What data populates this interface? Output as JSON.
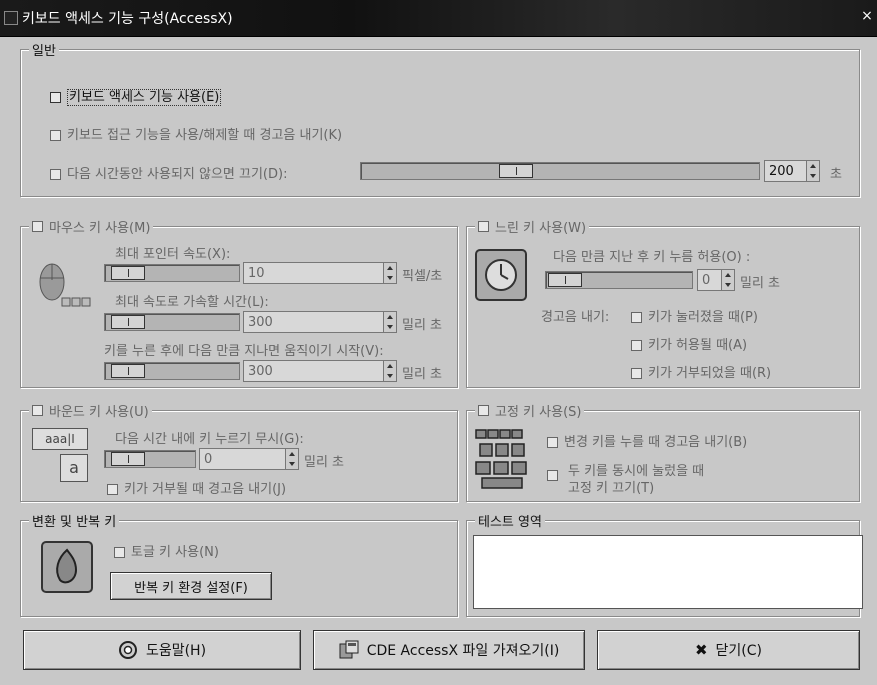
{
  "window": {
    "title": "키보드 액세스 기능 구성(AccessX)",
    "close_glyph": "×"
  },
  "general": {
    "legend": "일반",
    "enable_label": "키보드 액세스 기능 사용(E)",
    "beep_toggle_label": "키보드 접근 기능을 사용/해제할 때 경고음 내기(K)",
    "timeout_label": "다음 시간동안 사용되지 않으면 끄기(D):",
    "timeout_value": "200",
    "timeout_unit": "초",
    "timeout_slider_level": 0.38
  },
  "mouse_keys": {
    "legend": "마우스 키 사용(M)",
    "max_speed_label": "최대 포인터 속도(X):",
    "max_speed_value": "10",
    "max_speed_unit": "픽셀/초",
    "accel_label": "최대 속도로 가속할 시간(L):",
    "accel_value": "300",
    "accel_unit": "밀리 초",
    "delay_label": "키를 누른 후에 다음 만큼 지나면 움직이기 시작(V):",
    "delay_value": "300",
    "delay_unit": "밀리 초"
  },
  "slow_keys": {
    "legend": "느린 키 사용(W)",
    "accept_label": "다음 만큼 지난 후 키 누름 허용(O) :",
    "accept_value": "0",
    "accept_unit": "밀리 초",
    "beep_label": "경고음 내기:",
    "pressed_label": "키가 눌러졌을 때(P)",
    "accepted_label": "키가 허용될 때(A)",
    "rejected_label": "키가 거부되었을 때(R)"
  },
  "bounce_keys": {
    "legend": "바운드 키 사용(U)",
    "ignore_label": "다음 시간 내에 키 누르기 무시(G):",
    "ignore_value": "0",
    "ignore_unit": "밀리 초",
    "reject_beep_label": "키가 거부될 때 경고음 내기(J)",
    "icon_text_top": "aaa|I",
    "icon_text_bottom": "a"
  },
  "sticky_keys": {
    "legend": "고정 키 사용(S)",
    "modifier_beep_label": "변경 키를 누를 때 경고음 내기(B)",
    "two_keys_label_1": "두 키를 동시에 눌렀을 때",
    "two_keys_label_2": "고정 키 끄기(T)"
  },
  "toggle_repeat": {
    "legend": "변환 및 반복 키",
    "toggle_label": "토글 키 사용(N)",
    "repeat_button": "반복 키 환경 설정(F)"
  },
  "test_area": {
    "legend": "테스트 영역",
    "value": ""
  },
  "buttons": {
    "help": "도움말(H)",
    "import": "CDE AccessX 파일 가져오기(I)",
    "close": "닫기(C)",
    "close_glyph": "✖"
  }
}
